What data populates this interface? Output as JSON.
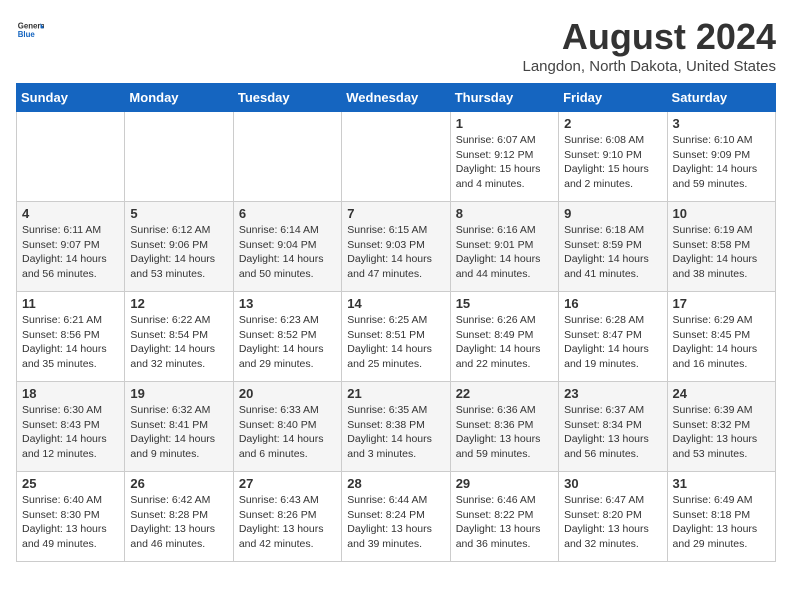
{
  "logo": {
    "general": "General",
    "blue": "Blue"
  },
  "header": {
    "month_year": "August 2024",
    "location": "Langdon, North Dakota, United States"
  },
  "days_of_week": [
    "Sunday",
    "Monday",
    "Tuesday",
    "Wednesday",
    "Thursday",
    "Friday",
    "Saturday"
  ],
  "weeks": [
    [
      {
        "day": "",
        "info": ""
      },
      {
        "day": "",
        "info": ""
      },
      {
        "day": "",
        "info": ""
      },
      {
        "day": "",
        "info": ""
      },
      {
        "day": "1",
        "info": "Sunrise: 6:07 AM\nSunset: 9:12 PM\nDaylight: 15 hours\nand 4 minutes."
      },
      {
        "day": "2",
        "info": "Sunrise: 6:08 AM\nSunset: 9:10 PM\nDaylight: 15 hours\nand 2 minutes."
      },
      {
        "day": "3",
        "info": "Sunrise: 6:10 AM\nSunset: 9:09 PM\nDaylight: 14 hours\nand 59 minutes."
      }
    ],
    [
      {
        "day": "4",
        "info": "Sunrise: 6:11 AM\nSunset: 9:07 PM\nDaylight: 14 hours\nand 56 minutes."
      },
      {
        "day": "5",
        "info": "Sunrise: 6:12 AM\nSunset: 9:06 PM\nDaylight: 14 hours\nand 53 minutes."
      },
      {
        "day": "6",
        "info": "Sunrise: 6:14 AM\nSunset: 9:04 PM\nDaylight: 14 hours\nand 50 minutes."
      },
      {
        "day": "7",
        "info": "Sunrise: 6:15 AM\nSunset: 9:03 PM\nDaylight: 14 hours\nand 47 minutes."
      },
      {
        "day": "8",
        "info": "Sunrise: 6:16 AM\nSunset: 9:01 PM\nDaylight: 14 hours\nand 44 minutes."
      },
      {
        "day": "9",
        "info": "Sunrise: 6:18 AM\nSunset: 8:59 PM\nDaylight: 14 hours\nand 41 minutes."
      },
      {
        "day": "10",
        "info": "Sunrise: 6:19 AM\nSunset: 8:58 PM\nDaylight: 14 hours\nand 38 minutes."
      }
    ],
    [
      {
        "day": "11",
        "info": "Sunrise: 6:21 AM\nSunset: 8:56 PM\nDaylight: 14 hours\nand 35 minutes."
      },
      {
        "day": "12",
        "info": "Sunrise: 6:22 AM\nSunset: 8:54 PM\nDaylight: 14 hours\nand 32 minutes."
      },
      {
        "day": "13",
        "info": "Sunrise: 6:23 AM\nSunset: 8:52 PM\nDaylight: 14 hours\nand 29 minutes."
      },
      {
        "day": "14",
        "info": "Sunrise: 6:25 AM\nSunset: 8:51 PM\nDaylight: 14 hours\nand 25 minutes."
      },
      {
        "day": "15",
        "info": "Sunrise: 6:26 AM\nSunset: 8:49 PM\nDaylight: 14 hours\nand 22 minutes."
      },
      {
        "day": "16",
        "info": "Sunrise: 6:28 AM\nSunset: 8:47 PM\nDaylight: 14 hours\nand 19 minutes."
      },
      {
        "day": "17",
        "info": "Sunrise: 6:29 AM\nSunset: 8:45 PM\nDaylight: 14 hours\nand 16 minutes."
      }
    ],
    [
      {
        "day": "18",
        "info": "Sunrise: 6:30 AM\nSunset: 8:43 PM\nDaylight: 14 hours\nand 12 minutes."
      },
      {
        "day": "19",
        "info": "Sunrise: 6:32 AM\nSunset: 8:41 PM\nDaylight: 14 hours\nand 9 minutes."
      },
      {
        "day": "20",
        "info": "Sunrise: 6:33 AM\nSunset: 8:40 PM\nDaylight: 14 hours\nand 6 minutes."
      },
      {
        "day": "21",
        "info": "Sunrise: 6:35 AM\nSunset: 8:38 PM\nDaylight: 14 hours\nand 3 minutes."
      },
      {
        "day": "22",
        "info": "Sunrise: 6:36 AM\nSunset: 8:36 PM\nDaylight: 13 hours\nand 59 minutes."
      },
      {
        "day": "23",
        "info": "Sunrise: 6:37 AM\nSunset: 8:34 PM\nDaylight: 13 hours\nand 56 minutes."
      },
      {
        "day": "24",
        "info": "Sunrise: 6:39 AM\nSunset: 8:32 PM\nDaylight: 13 hours\nand 53 minutes."
      }
    ],
    [
      {
        "day": "25",
        "info": "Sunrise: 6:40 AM\nSunset: 8:30 PM\nDaylight: 13 hours\nand 49 minutes."
      },
      {
        "day": "26",
        "info": "Sunrise: 6:42 AM\nSunset: 8:28 PM\nDaylight: 13 hours\nand 46 minutes."
      },
      {
        "day": "27",
        "info": "Sunrise: 6:43 AM\nSunset: 8:26 PM\nDaylight: 13 hours\nand 42 minutes."
      },
      {
        "day": "28",
        "info": "Sunrise: 6:44 AM\nSunset: 8:24 PM\nDaylight: 13 hours\nand 39 minutes."
      },
      {
        "day": "29",
        "info": "Sunrise: 6:46 AM\nSunset: 8:22 PM\nDaylight: 13 hours\nand 36 minutes."
      },
      {
        "day": "30",
        "info": "Sunrise: 6:47 AM\nSunset: 8:20 PM\nDaylight: 13 hours\nand 32 minutes."
      },
      {
        "day": "31",
        "info": "Sunrise: 6:49 AM\nSunset: 8:18 PM\nDaylight: 13 hours\nand 29 minutes."
      }
    ]
  ]
}
